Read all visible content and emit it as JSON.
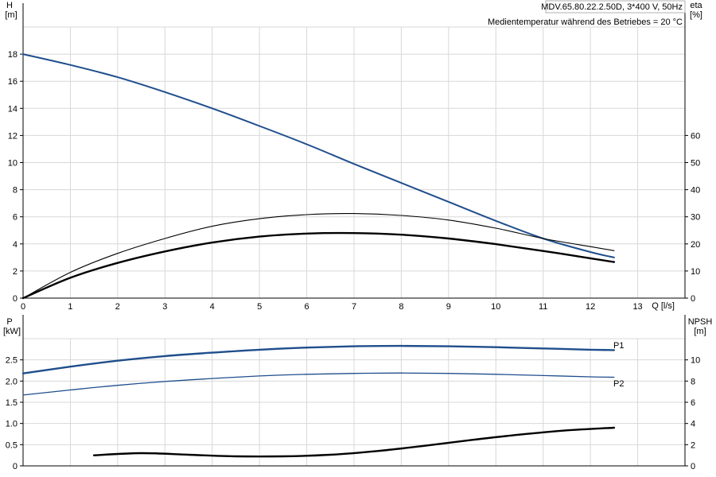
{
  "header": {
    "model": "MDV.65.80.22.2.50D, 3*400 V, 50Hz",
    "temperature": "Medientemperatur während des Betriebes = 20 °C"
  },
  "chart_data": [
    {
      "type": "line",
      "xlabel": "Q [l/s]",
      "xlim": [
        0,
        14
      ],
      "x_ticks": [
        0,
        1,
        2,
        3,
        4,
        5,
        6,
        7,
        8,
        9,
        10,
        11,
        12,
        13
      ],
      "y_axis": {
        "label_top": "H",
        "label_unit": "[m]",
        "ylim": [
          0,
          20
        ],
        "ticks": [
          0,
          2,
          4,
          6,
          8,
          10,
          12,
          14,
          16,
          18
        ]
      },
      "y2_axis": {
        "label_top": "eta",
        "label_unit": "[%]",
        "ylim": [
          0,
          100
        ],
        "ticks": [
          0,
          10,
          20,
          30,
          40,
          50,
          60
        ]
      },
      "grid": true,
      "series": [
        {
          "key": "head",
          "axis": "left",
          "color": "#1f4e8c",
          "x": [
            0,
            1,
            2,
            3,
            4,
            5,
            6,
            7,
            8,
            9,
            10,
            11,
            12,
            12.5
          ],
          "y": [
            18.0,
            17.2,
            16.3,
            15.2,
            14.0,
            12.7,
            11.35,
            9.9,
            8.5,
            7.1,
            5.7,
            4.4,
            3.4,
            3.0
          ]
        },
        {
          "key": "efficiency_thin",
          "axis": "right",
          "color": "#000000",
          "x": [
            0,
            1,
            2,
            3,
            4,
            5,
            6,
            7,
            8,
            9,
            10,
            11,
            12,
            12.5
          ],
          "y": [
            0,
            9.5,
            16.5,
            22.0,
            26.5,
            29.3,
            30.8,
            31.2,
            30.5,
            28.8,
            25.8,
            22.0,
            19.0,
            17.5
          ]
        },
        {
          "key": "efficiency_thick",
          "axis": "right",
          "color": "#000000",
          "x": [
            0,
            1,
            2,
            3,
            4,
            5,
            6,
            7,
            8,
            9,
            10,
            11,
            12,
            12.5
          ],
          "y": [
            0,
            7.5,
            13.0,
            17.2,
            20.5,
            22.7,
            23.8,
            24.0,
            23.4,
            22.0,
            19.9,
            17.4,
            14.7,
            13.3
          ]
        }
      ]
    },
    {
      "type": "line",
      "xlim": [
        0,
        14
      ],
      "y_axis": {
        "label_top": "P",
        "label_unit": "[kW]",
        "ylim": [
          0,
          3.0
        ],
        "ticks": [
          0,
          0.5,
          1.0,
          1.5,
          2.0,
          2.5
        ]
      },
      "y2_axis": {
        "label_top": "NPSH",
        "label_unit": "[m]",
        "ylim": [
          0,
          12
        ],
        "ticks": [
          0,
          2,
          4,
          6,
          8,
          10
        ]
      },
      "grid": true,
      "series": [
        {
          "name": "P1",
          "axis": "left",
          "color": "#1f4e8c",
          "x": [
            0,
            1,
            2,
            3,
            4,
            5,
            6,
            7,
            8,
            9,
            10,
            11,
            12,
            12.5
          ],
          "y": [
            2.18,
            2.34,
            2.48,
            2.59,
            2.67,
            2.74,
            2.79,
            2.82,
            2.83,
            2.82,
            2.8,
            2.77,
            2.74,
            2.73
          ]
        },
        {
          "name": "P2",
          "axis": "left",
          "color": "#1f4e8c",
          "x": [
            0,
            1,
            2,
            3,
            4,
            5,
            6,
            7,
            8,
            9,
            10,
            11,
            12,
            12.5
          ],
          "y": [
            1.67,
            1.79,
            1.9,
            1.99,
            2.06,
            2.12,
            2.16,
            2.18,
            2.19,
            2.18,
            2.16,
            2.13,
            2.1,
            2.09
          ]
        },
        {
          "key": "npsh",
          "axis": "right",
          "color": "#000000",
          "x": [
            1.5,
            2.5,
            3.5,
            4.5,
            5.5,
            6.5,
            7.5,
            8.5,
            9.5,
            10.5,
            11.5,
            12.5
          ],
          "y": [
            1.0,
            1.2,
            1.05,
            0.9,
            0.9,
            1.05,
            1.4,
            1.9,
            2.45,
            2.95,
            3.35,
            3.6
          ]
        }
      ]
    }
  ]
}
